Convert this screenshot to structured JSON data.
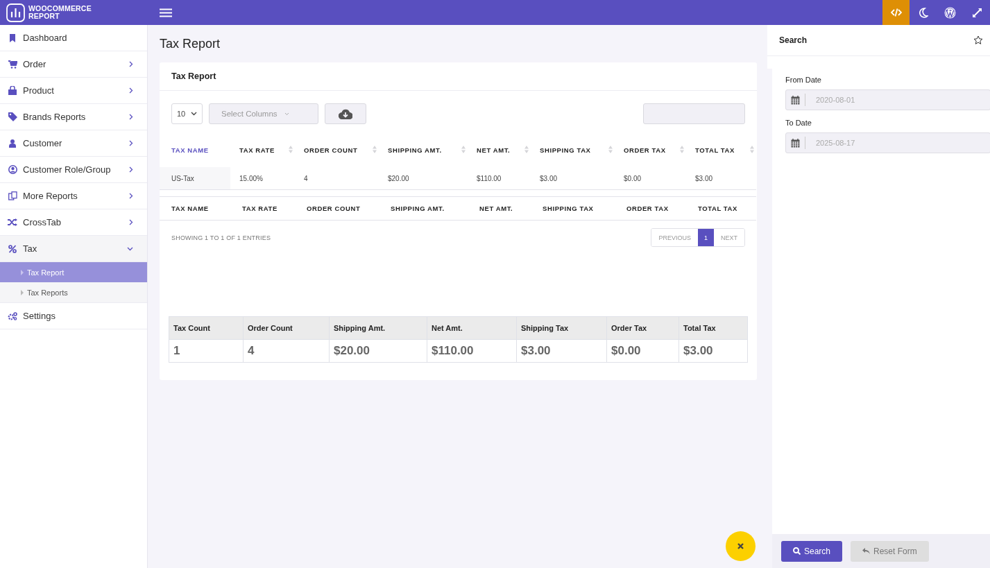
{
  "brand": {
    "line1": "WOOCOMMERCE",
    "line2": "REPORT"
  },
  "topbar": {
    "actions": [
      {
        "kind": "code",
        "selected": true
      },
      {
        "kind": "moon",
        "selected": false
      },
      {
        "kind": "wordpress",
        "selected": false
      },
      {
        "kind": "expand",
        "selected": false
      }
    ]
  },
  "sidebar": {
    "items": [
      {
        "label": "Dashboard",
        "kind": "link"
      },
      {
        "label": "Order",
        "kind": "menu",
        "expanded": false
      },
      {
        "label": "Product",
        "kind": "menu",
        "expanded": false
      },
      {
        "label": "Brands Reports",
        "kind": "menu",
        "expanded": false
      },
      {
        "label": "Customer",
        "kind": "menu",
        "expanded": false
      },
      {
        "label": "Customer Role/Group",
        "kind": "menu",
        "expanded": false
      },
      {
        "label": "More Reports",
        "kind": "menu",
        "expanded": false
      },
      {
        "label": "CrossTab",
        "kind": "menu",
        "expanded": false
      },
      {
        "label": "Tax",
        "kind": "menu",
        "expanded": true,
        "children": [
          {
            "label": "Tax Report",
            "selected": true
          },
          {
            "label": "Tax Reports",
            "selected": false
          }
        ]
      },
      {
        "label": "Settings",
        "kind": "link"
      }
    ]
  },
  "page_title": "Tax Report",
  "card": {
    "title": "Tax Report",
    "page_length": "10",
    "columns_placeholder": "Select Columns",
    "table": {
      "columns": [
        {
          "label": "TAX NAME",
          "sorted": true
        },
        {
          "label": "TAX RATE",
          "sorted": false
        },
        {
          "label": "ORDER COUNT",
          "sorted": false
        },
        {
          "label": "SHIPPING AMT.",
          "sorted": false
        },
        {
          "label": "NET AMT.",
          "sorted": false
        },
        {
          "label": "SHIPPING TAX",
          "sorted": false
        },
        {
          "label": "ORDER TAX",
          "sorted": false
        },
        {
          "label": "TOTAL TAX",
          "sorted": false
        }
      ],
      "rows": [
        [
          "US-Tax",
          "15.00%",
          "4",
          "$20.00",
          "$110.00",
          "$3.00",
          "$0.00",
          "$3.00"
        ]
      ],
      "footer_columns": [
        "TAX NAME",
        "TAX RATE",
        "ORDER COUNT",
        "SHIPPING AMT.",
        "NET AMT.",
        "SHIPPING TAX",
        "ORDER TAX",
        "TOTAL TAX"
      ]
    },
    "info": "SHOWING 1 TO 1 OF 1 ENTRIES",
    "pagination": [
      {
        "label": "PREVIOUS",
        "selected": false
      },
      {
        "label": "1",
        "selected": true
      },
      {
        "label": "NEXT",
        "selected": false
      }
    ],
    "summary": {
      "columns": [
        "Tax Count",
        "Order Count",
        "Shipping Amt.",
        "Net Amt.",
        "Shipping Tax",
        "Order Tax",
        "Total Tax"
      ],
      "values": [
        "1",
        "4",
        "$20.00",
        "$110.00",
        "$3.00",
        "$0.00",
        "$3.00"
      ]
    }
  },
  "search_panel": {
    "title": "Search",
    "fields": [
      {
        "label": "From Date",
        "value": "2020-08-01"
      },
      {
        "label": "To Date",
        "value": "2025-08-17"
      }
    ],
    "buttons": [
      {
        "label": "Search",
        "kind": "primary"
      },
      {
        "label": "Reset Form",
        "kind": "secondary"
      }
    ]
  }
}
